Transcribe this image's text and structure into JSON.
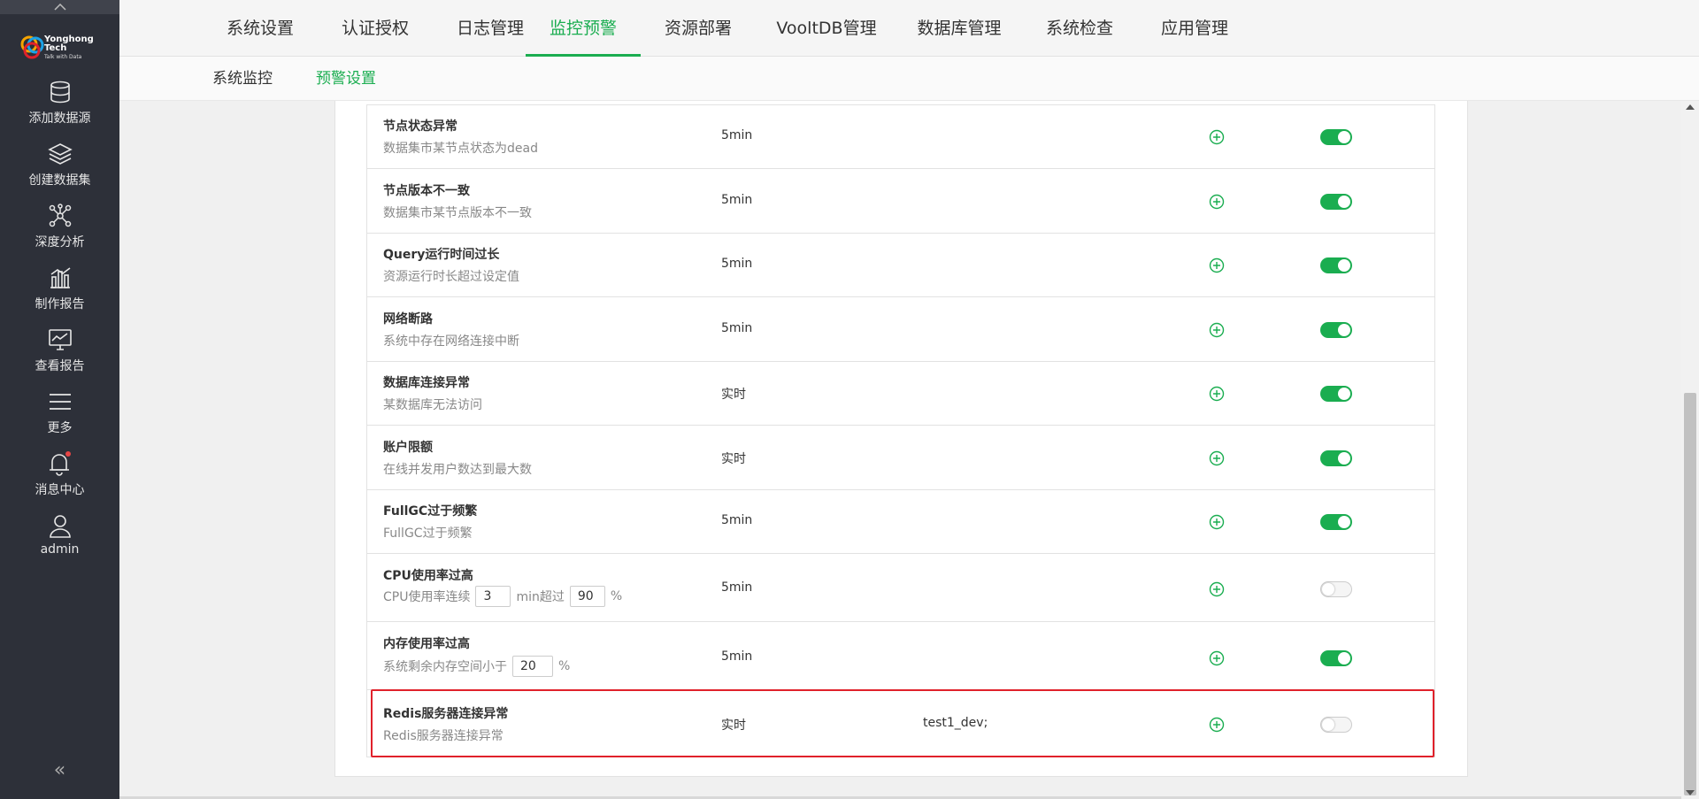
{
  "sidebar": {
    "logo": {
      "brand": "Yonghong Tech",
      "tagline": "Talk with Data"
    },
    "items": [
      {
        "label": "添加数据源",
        "icon": "database-icon"
      },
      {
        "label": "创建数据集",
        "icon": "layers-icon"
      },
      {
        "label": "深度分析",
        "icon": "network-icon"
      },
      {
        "label": "制作报告",
        "icon": "bar-chart-icon"
      },
      {
        "label": "查看报告",
        "icon": "monitor-chart-icon"
      },
      {
        "label": "更多",
        "icon": "menu-icon"
      },
      {
        "label": "消息中心",
        "icon": "bell-icon"
      },
      {
        "label": "admin",
        "icon": "user-icon"
      }
    ],
    "collapse_glyph": "«"
  },
  "topnav": {
    "tabs": [
      {
        "label": "系统设置",
        "active": false
      },
      {
        "label": "认证授权",
        "active": false
      },
      {
        "label": "日志管理",
        "active": false
      },
      {
        "label": "监控预警",
        "active": true
      },
      {
        "label": "资源部署",
        "active": false
      },
      {
        "label": "VooltDB管理",
        "active": false
      },
      {
        "label": "数据库管理",
        "active": false
      },
      {
        "label": "系统检查",
        "active": false
      },
      {
        "label": "应用管理",
        "active": false
      }
    ]
  },
  "subnav": {
    "tabs": [
      {
        "label": "系统监控",
        "active": false
      },
      {
        "label": "预警设置",
        "active": true
      }
    ]
  },
  "alerts": [
    {
      "title": "节点状态异常",
      "desc": "数据集市某节点状态为dead",
      "frequency": "5min",
      "target": "",
      "enabled": true
    },
    {
      "title": "节点版本不一致",
      "desc": "数据集市某节点版本不一致",
      "frequency": "5min",
      "target": "",
      "enabled": true
    },
    {
      "title": "Query运行时间过长",
      "desc": "资源运行时长超过设定值",
      "frequency": "5min",
      "target": "",
      "enabled": true
    },
    {
      "title": "网络断路",
      "desc": "系统中存在网络连接中断",
      "frequency": "5min",
      "target": "",
      "enabled": true
    },
    {
      "title": "数据库连接异常",
      "desc": "某数据库无法访问",
      "frequency": "实时",
      "target": "",
      "enabled": true
    },
    {
      "title": "账户限额",
      "desc": "在线并发用户数达到最大数",
      "frequency": "实时",
      "target": "",
      "enabled": true
    },
    {
      "title": "FullGC过于频繁",
      "desc": "FullGC过于频繁",
      "frequency": "5min",
      "target": "",
      "enabled": true
    },
    {
      "title": "CPU使用率过高",
      "desc_parts": [
        "CPU使用率连续",
        "min超过",
        "%"
      ],
      "inputs": [
        "3",
        "90"
      ],
      "frequency": "5min",
      "target": "",
      "enabled": false
    },
    {
      "title": "内存使用率过高",
      "desc_parts": [
        "系统剩余内存空间小于",
        "%"
      ],
      "inputs": [
        "20"
      ],
      "frequency": "5min",
      "target": "",
      "enabled": true
    },
    {
      "title": "Redis服务器连接异常",
      "desc": "Redis服务器连接异常",
      "frequency": "实时",
      "target": "test1_dev;",
      "enabled": false
    }
  ],
  "colors": {
    "accent": "#1aad50",
    "highlight": "#e0212b",
    "sidebar": "#2d3039"
  }
}
